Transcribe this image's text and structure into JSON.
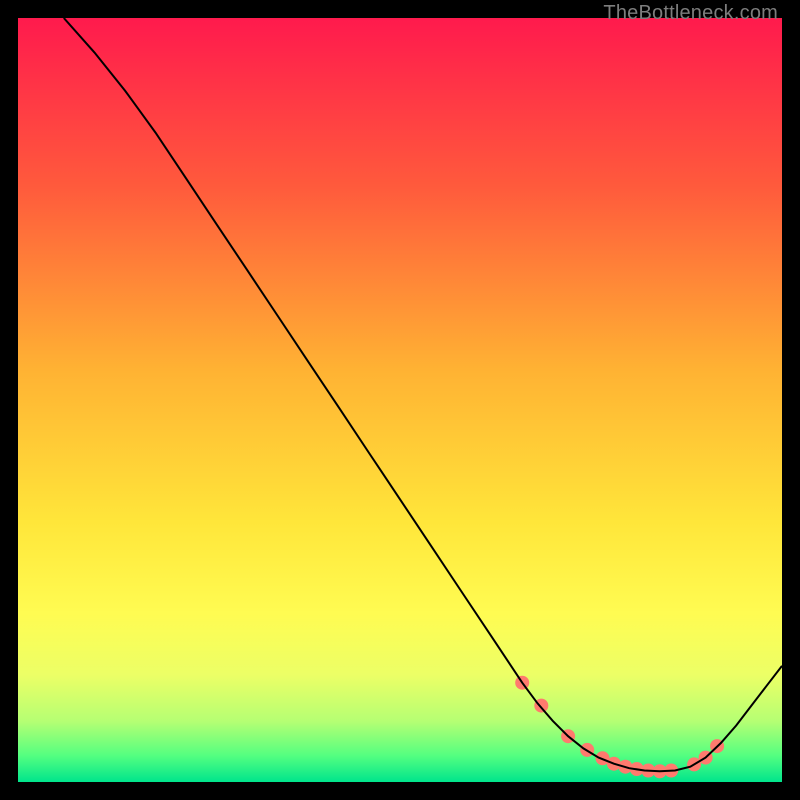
{
  "watermark": "TheBottleneck.com",
  "chart_data": {
    "type": "line",
    "title": "",
    "xlabel": "",
    "ylabel": "",
    "xlim": [
      0,
      100
    ],
    "ylim": [
      0,
      100
    ],
    "background_gradient": {
      "orientation": "vertical",
      "stops": [
        {
          "pos": 0.0,
          "color": "#ff1a4d"
        },
        {
          "pos": 0.22,
          "color": "#ff5a3c"
        },
        {
          "pos": 0.46,
          "color": "#ffb233"
        },
        {
          "pos": 0.66,
          "color": "#ffe63a"
        },
        {
          "pos": 0.78,
          "color": "#fffc52"
        },
        {
          "pos": 0.86,
          "color": "#ecff66"
        },
        {
          "pos": 0.92,
          "color": "#b6ff73"
        },
        {
          "pos": 0.965,
          "color": "#55ff80"
        },
        {
          "pos": 1.0,
          "color": "#00e58c"
        }
      ]
    },
    "series": [
      {
        "name": "bottleneck-curve",
        "color": "#000000",
        "stroke_width": 2,
        "x": [
          6,
          10,
          14,
          18,
          22,
          26,
          30,
          34,
          38,
          42,
          46,
          50,
          54,
          58,
          62,
          66,
          68,
          70,
          72,
          74,
          76,
          78,
          80,
          82,
          84,
          86,
          88,
          90,
          92,
          94,
          96,
          98,
          100
        ],
        "y": [
          100,
          95.5,
          90.5,
          85,
          79,
          73,
          67,
          61,
          55,
          49,
          43,
          37,
          31,
          25,
          19,
          13,
          10.3,
          8.0,
          6.0,
          4.4,
          3.2,
          2.4,
          1.8,
          1.5,
          1.4,
          1.5,
          2.0,
          3.2,
          5.1,
          7.4,
          10.0,
          12.6,
          15.2
        ]
      }
    ],
    "markers": {
      "name": "highlighted-points",
      "color": "#ff7a6e",
      "radius": 7,
      "x": [
        66.0,
        68.5,
        72.0,
        74.5,
        76.5,
        78.0,
        79.5,
        81.0,
        82.5,
        84.0,
        85.5,
        88.5,
        90.0,
        91.5
      ],
      "y": [
        13.0,
        10.0,
        6.0,
        4.2,
        3.1,
        2.4,
        2.0,
        1.7,
        1.5,
        1.4,
        1.5,
        2.3,
        3.2,
        4.7
      ]
    }
  }
}
